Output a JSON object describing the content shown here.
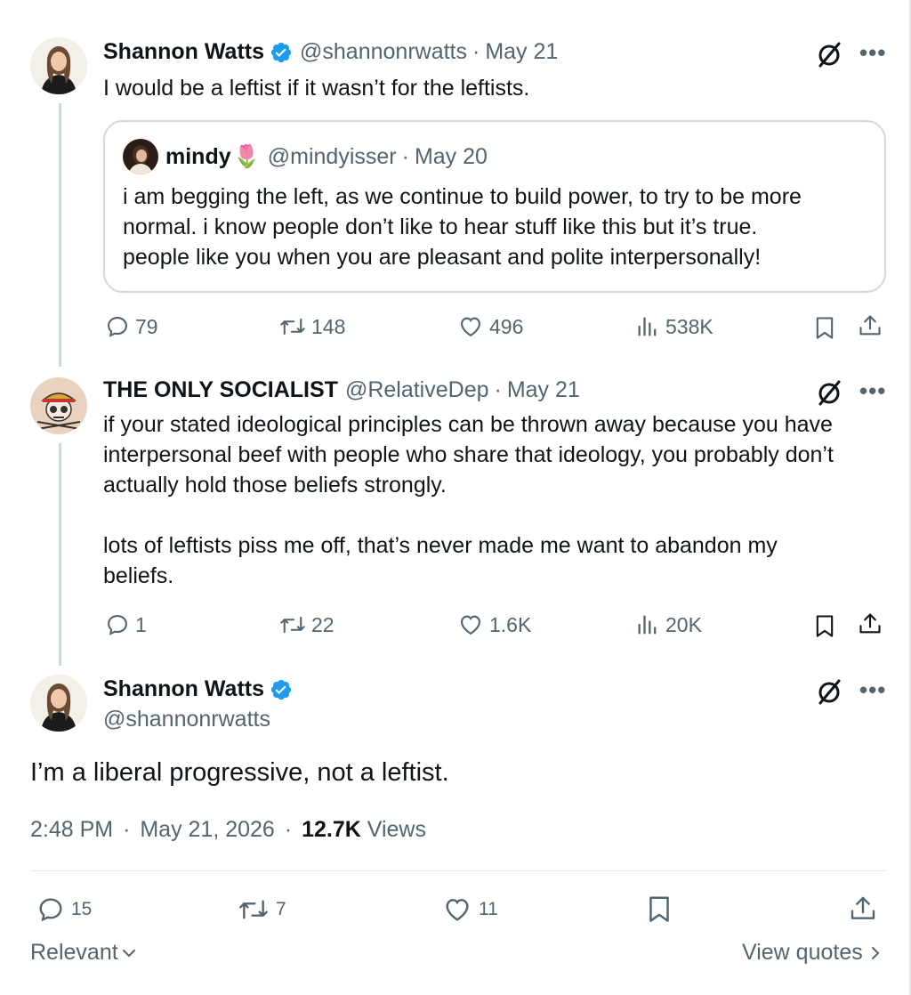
{
  "tweet1": {
    "name": "Shannon Watts",
    "handle": "@shannonrwatts",
    "sep": "·",
    "date": "May 21",
    "text": "I would be a leftist if it wasn’t for the leftists.",
    "quote": {
      "name": "mindy",
      "emoji": "🌷",
      "handle": "@mindyisser",
      "sep": "·",
      "date": "May 20",
      "lines": [
        "i am begging the left, as we continue to build power, to try to be more",
        "normal. i know people don’t like to hear stuff like this but it’s true.",
        "people like you when you are pleasant and polite interpersonally!"
      ]
    },
    "stats": {
      "replies": "79",
      "reposts": "148",
      "likes": "496",
      "views": "538K"
    }
  },
  "tweet2": {
    "name": "THE ONLY SOCIALIST",
    "handle": "@RelativeDep",
    "sep": "·",
    "date": "May 21",
    "lines": [
      "if your stated ideological principles can be thrown away because you have",
      "interpersonal beef with people who share that ideology, you probably don’t",
      "actually hold those beliefs strongly.",
      "",
      "lots of leftists piss me off, that’s never made me want to abandon my",
      "beliefs."
    ],
    "stats": {
      "replies": "1",
      "reposts": "22",
      "likes": "1.6K",
      "views": "20K"
    }
  },
  "main": {
    "name": "Shannon Watts",
    "handle": "@shannonrwatts",
    "text": "I’m a liberal progressive, not a leftist.",
    "time": "2:48 PM",
    "sep1": "·",
    "date": "May 21, 2026",
    "sep2": "·",
    "views_count": "12.7K",
    "views_label": "Views",
    "stats": {
      "replies": "15",
      "reposts": "7",
      "likes": "11"
    }
  },
  "footer": {
    "relevant": "Relevant",
    "view_quotes": "View quotes"
  },
  "icons": {
    "more": "more-horizontal-icon",
    "grok": "grok-icon",
    "verified": "verified-badge-icon",
    "reply": "reply-icon",
    "repost": "repost-icon",
    "like": "like-icon",
    "views": "views-icon",
    "bookmark": "bookmark-icon",
    "share": "share-icon"
  },
  "colors": {
    "verified": "#1d9bf0",
    "secondary_text": "#536471",
    "border": "#cfd9de"
  }
}
